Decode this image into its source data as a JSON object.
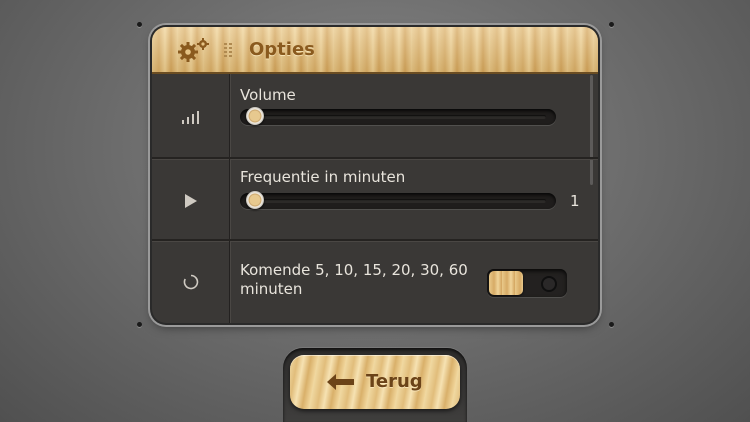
{
  "header": {
    "title": "Opties"
  },
  "rows": {
    "volume": {
      "label": "Volume",
      "level": 0
    },
    "frequency": {
      "label": "Frequentie in minuten",
      "value": "1",
      "level": 0
    },
    "upcoming": {
      "label_line1": "Komende 5, 10, 15, 20, 30, 60",
      "label_line2": "minuten",
      "toggle_on": true
    }
  },
  "footer": {
    "back_label": "Terug"
  },
  "icons": [
    "gear-icon",
    "grip-icon",
    "signal-bars-icon",
    "play-icon",
    "refresh-icon",
    "back-arrow-icon"
  ],
  "colors": {
    "wood": "#e3bd7c",
    "panel": "#3a3836",
    "text": "#e8e4dc",
    "wood_text": "#8a5a1e"
  }
}
